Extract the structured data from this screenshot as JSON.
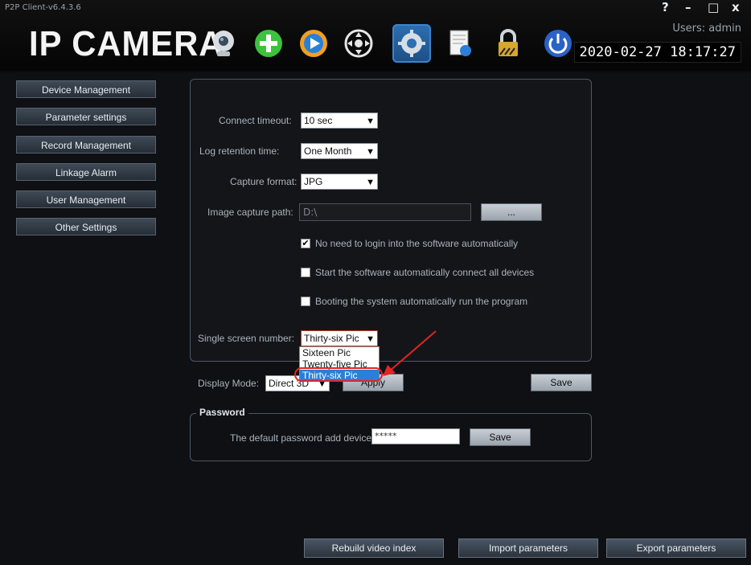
{
  "window": {
    "title": "P2P Client-v6.4.3.6",
    "help": "?",
    "minimize": "–",
    "maximize": "□",
    "close": "x"
  },
  "header": {
    "brand": "IP CAMERA",
    "user": "Users: admin",
    "datetime": "2020-02-27 18:17:27"
  },
  "toolbar": [
    {
      "name": "camera-icon"
    },
    {
      "name": "add-icon"
    },
    {
      "name": "play-icon"
    },
    {
      "name": "ptz-icon"
    },
    {
      "name": "settings-icon",
      "active": true
    },
    {
      "name": "log-icon"
    },
    {
      "name": "lock-icon"
    },
    {
      "name": "power-icon"
    }
  ],
  "sidebar": {
    "items": [
      {
        "label": "Device Management"
      },
      {
        "label": "Parameter settings"
      },
      {
        "label": "Record Management"
      },
      {
        "label": "Linkage Alarm"
      },
      {
        "label": "User Management"
      },
      {
        "label": "Other Settings"
      }
    ]
  },
  "settings": {
    "connect_timeout": {
      "label": "Connect timeout:",
      "value": "10 sec"
    },
    "log_retention": {
      "label": "Log retention time:",
      "value": "One Month"
    },
    "capture_format": {
      "label": "Capture format:",
      "value": "JPG"
    },
    "capture_path": {
      "label": "Image capture path:",
      "value": "D:\\",
      "browse": "..."
    },
    "checks": [
      {
        "label": "No need to login into the software automatically",
        "checked": true
      },
      {
        "label": "Start the software automatically connect all devices",
        "checked": false
      },
      {
        "label": "Booting the system automatically run the program",
        "checked": false
      }
    ],
    "single_screen": {
      "label": "Single screen number:",
      "value": "Thirty-six Pic",
      "options": [
        "Sixteen Pic",
        "Twenty-five Pic",
        "Thirty-six Pic"
      ]
    },
    "display_mode": {
      "label": "Display Mode:",
      "value": "Direct 3D"
    },
    "apply": "Apply",
    "save": "Save"
  },
  "password": {
    "legend": "Password",
    "label": "The default password add device",
    "value": "*****",
    "save": "Save"
  },
  "bottom": {
    "rebuild": "Rebuild video index",
    "import": "Import parameters",
    "export": "Export parameters"
  },
  "colors": {
    "accent": "#2a7fd8",
    "annotation": "#e22525"
  }
}
